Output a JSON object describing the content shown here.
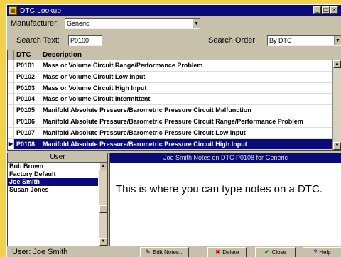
{
  "window": {
    "title": "DTC Lookup",
    "controls": {
      "minimize": "_",
      "maximize": "□",
      "close": "×"
    }
  },
  "filters": {
    "manufacturer_label": "Manufacturer:",
    "manufacturer_value": "Generic",
    "search_text_label": "Search Text:",
    "search_text_value": "P0100",
    "search_order_label": "Search Order:",
    "search_order_value": "By DTC"
  },
  "dtc_table": {
    "columns": [
      "DTC",
      "Description"
    ],
    "rows": [
      {
        "dtc": "P0101",
        "description": "Mass or Volume Circuit Range/Performance Problem"
      },
      {
        "dtc": "P0102",
        "description": "Mass or Volume Circuit Low Input"
      },
      {
        "dtc": "P0103",
        "description": "Mass or Volume Circuit High Input"
      },
      {
        "dtc": "P0104",
        "description": "Mass or Volume Circuit Intermittent"
      },
      {
        "dtc": "P0105",
        "description": "Manifold Absolute Pressure/Barometric Pressure Circuit Malfunction"
      },
      {
        "dtc": "P0106",
        "description": "Manifold Absolute Pressure/Barometric Pressure Circuit Range/Performance Problem"
      },
      {
        "dtc": "P0107",
        "description": "Manifold Absolute Pressure/Barometric Pressure Circuit Low Input"
      },
      {
        "dtc": "P0108",
        "description": "Manifold Absolute Pressure/Barometric Pressure Circuit High Input"
      }
    ],
    "selected_index": 7
  },
  "users_panel": {
    "header": "User",
    "items": [
      "Bob Brown",
      "Factory Default",
      "Joe Smith",
      "Susan Jones"
    ],
    "selected_index": 2
  },
  "notes_panel": {
    "header": "Joe Smith Notes on DTC P0108 for Generic",
    "text": "This is where you can type notes on a DTC."
  },
  "status": {
    "user_text": "User: Joe Smith"
  },
  "buttons": {
    "edit_notes": "Edit Notes...",
    "delete": "Delete",
    "close": "Close",
    "help": "Help"
  },
  "colors": {
    "title_bar": "#0a0a78",
    "background": "#f3d14a",
    "selection": "#0a0a78"
  }
}
